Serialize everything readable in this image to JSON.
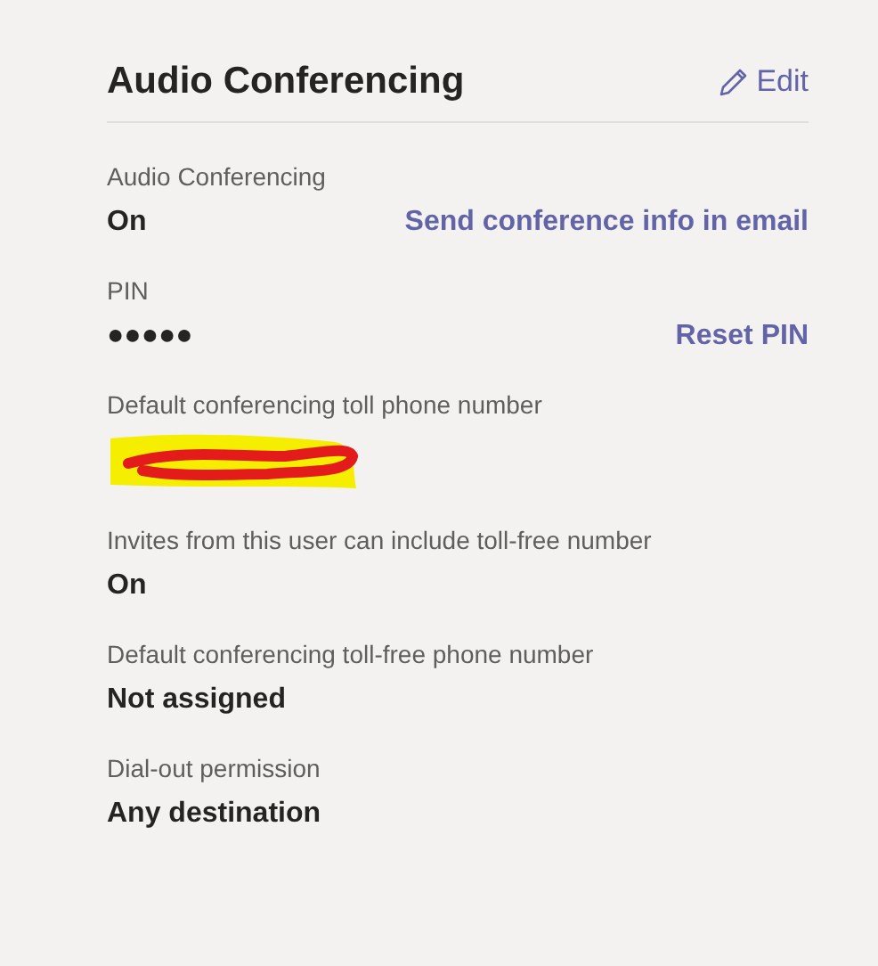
{
  "title": "Audio Conferencing",
  "edit": {
    "label": "Edit"
  },
  "fields": [
    {
      "kind": "text",
      "label": "Audio Conferencing",
      "value": "On",
      "action": "Send conference info in email"
    },
    {
      "kind": "text",
      "label": "PIN",
      "value": "●●●●●",
      "action": "Reset PIN"
    },
    {
      "kind": "redacted",
      "label": "Default conferencing toll phone number"
    },
    {
      "kind": "text",
      "label": "Invites from this user can include toll-free number",
      "value": "On"
    },
    {
      "kind": "text",
      "label": "Default conferencing toll-free phone number",
      "value": "Not assigned"
    },
    {
      "kind": "text",
      "label": "Dial-out permission",
      "value": "Any destination"
    }
  ]
}
